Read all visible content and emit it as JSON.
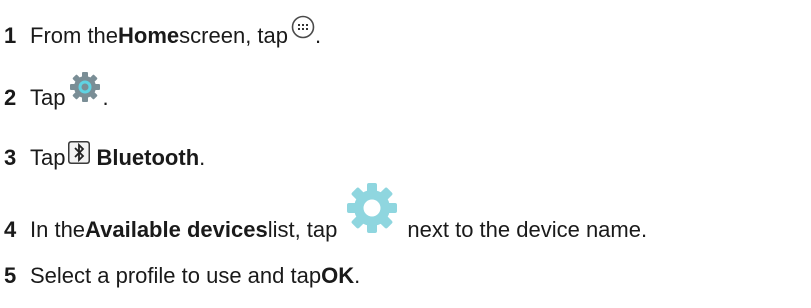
{
  "steps": [
    {
      "number": "1",
      "pre": "From the ",
      "bold": "Home",
      "post": " screen, tap ",
      "icon": "apps-grid-icon",
      "after": "."
    },
    {
      "number": "2",
      "pre": "Tap ",
      "icon": "settings-gear-icon",
      "after": "."
    },
    {
      "number": "3",
      "pre": "Tap ",
      "icon": "bluetooth-icon",
      "bold": "Bluetooth",
      "after": "."
    },
    {
      "number": "4",
      "pre": "In the ",
      "bold": "Available devices",
      "post": " list, tap ",
      "icon": "device-settings-gear-icon",
      "after": "next to the device name."
    },
    {
      "number": "5",
      "pre": "Select a profile to use and tap ",
      "bold": "OK",
      "after": "."
    }
  ],
  "colors": {
    "gear_dark": "#7a8e96",
    "gear_center": "#5fd3e3",
    "gear_light": "#8fd6df",
    "text": "#1a1a1a"
  }
}
